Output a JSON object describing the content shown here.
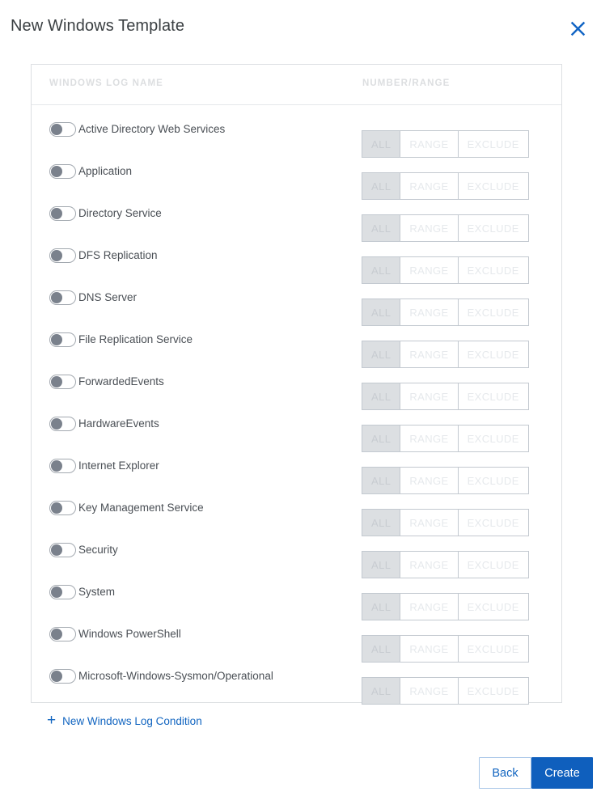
{
  "dialog": {
    "title": "New Windows Template",
    "close_icon": "close-icon"
  },
  "table": {
    "headers": {
      "log_name": "WINDOWS LOG NAME",
      "number_range": "NUMBER/RANGE"
    },
    "segment_options": [
      "ALL",
      "RANGE",
      "EXCLUDE"
    ],
    "selected_segment": "ALL",
    "rows": [
      {
        "label": "Active Directory Web Services",
        "enabled": false,
        "mode": "ALL"
      },
      {
        "label": "Application",
        "enabled": false,
        "mode": "ALL"
      },
      {
        "label": "Directory Service",
        "enabled": false,
        "mode": "ALL"
      },
      {
        "label": "DFS Replication",
        "enabled": false,
        "mode": "ALL"
      },
      {
        "label": "DNS Server",
        "enabled": false,
        "mode": "ALL"
      },
      {
        "label": "File Replication Service",
        "enabled": false,
        "mode": "ALL"
      },
      {
        "label": "ForwardedEvents",
        "enabled": false,
        "mode": "ALL"
      },
      {
        "label": "HardwareEvents",
        "enabled": false,
        "mode": "ALL"
      },
      {
        "label": "Internet Explorer",
        "enabled": false,
        "mode": "ALL"
      },
      {
        "label": "Key Management Service",
        "enabled": false,
        "mode": "ALL"
      },
      {
        "label": "Security",
        "enabled": false,
        "mode": "ALL"
      },
      {
        "label": "System",
        "enabled": false,
        "mode": "ALL"
      },
      {
        "label": "Windows PowerShell",
        "enabled": false,
        "mode": "ALL"
      },
      {
        "label": "Microsoft-Windows-Sysmon/Operational",
        "enabled": false,
        "mode": "ALL"
      }
    ]
  },
  "add_condition": {
    "label": "New Windows Log Condition",
    "icon": "plus-icon"
  },
  "footer": {
    "back_label": "Back",
    "create_label": "Create"
  },
  "colors": {
    "accent_blue": "#1064c0",
    "primary_button": "#0f5fbd",
    "panel_border": "#dcdfe2",
    "header_text": "#dcdee0",
    "row_text": "#4a4f55",
    "toggle_knob": "#7a818c",
    "segment_selected_bg": "#dcdfe2"
  }
}
